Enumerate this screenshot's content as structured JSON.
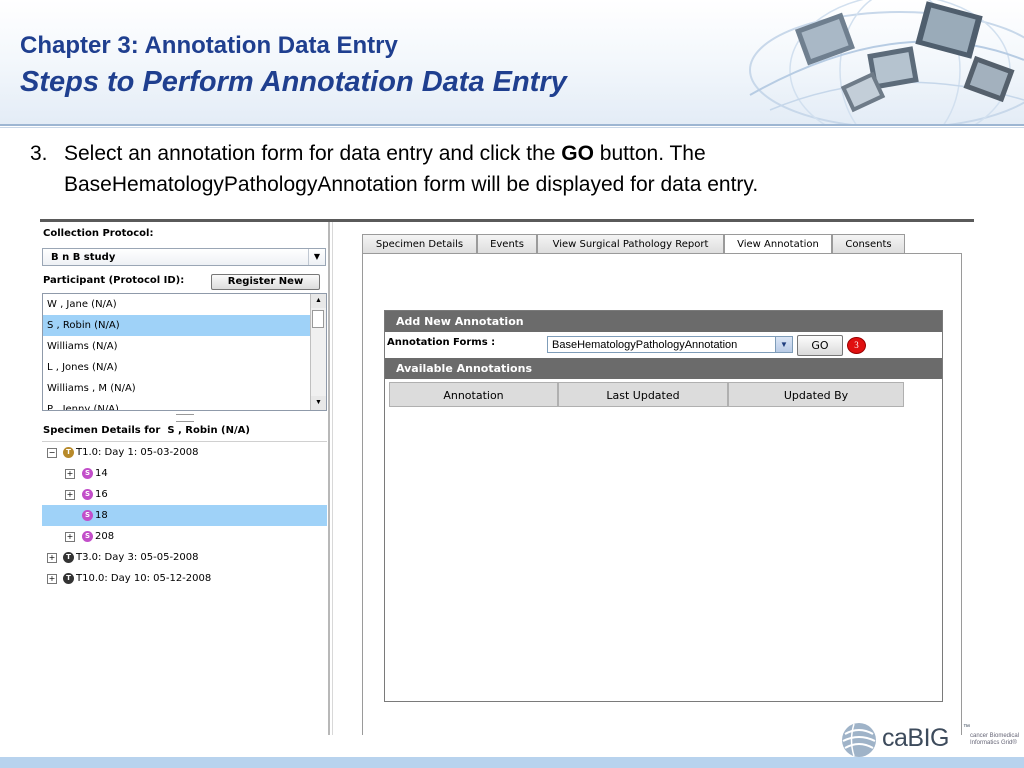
{
  "slide": {
    "chapter_title": "Chapter 3: Annotation Data Entry",
    "subtitle": "Steps to Perform Annotation Data Entry"
  },
  "step": {
    "number": "3.",
    "text_before": "Select an annotation form for data entry and click the ",
    "bold_word": "GO",
    "text_after": " button. The BaseHematologyPathologyAnnotation form will be displayed for data entry."
  },
  "left_panel": {
    "collection_protocol_label": "Collection Protocol:",
    "collection_protocol_value": "B n B study",
    "participant_label": "Participant (Protocol ID):",
    "register_new_label": "Register New",
    "participants": [
      {
        "name": "W , Jane (N/A)",
        "selected": false
      },
      {
        "name": "S , Robin (N/A)",
        "selected": true
      },
      {
        "name": "Williams (N/A)",
        "selected": false
      },
      {
        "name": "L , Jones (N/A)",
        "selected": false
      },
      {
        "name": "Williams , M (N/A)",
        "selected": false
      },
      {
        "name": "P , Jenny (N/A)",
        "selected": false
      }
    ],
    "specimen_details_label": "Specimen Details for",
    "specimen_details_for": "S , Robin (N/A)",
    "tree": [
      {
        "label": "T1.0: Day 1: 05-03-2008",
        "toggle": "−",
        "icon": "T",
        "level": 0
      },
      {
        "label": "14",
        "toggle": "+",
        "icon": "S",
        "level": 1
      },
      {
        "label": "16",
        "toggle": "+",
        "icon": "S",
        "level": 1
      },
      {
        "label": "18",
        "toggle": "",
        "icon": "S",
        "level": 1,
        "selected": true
      },
      {
        "label": "208",
        "toggle": "+",
        "icon": "S",
        "level": 1
      },
      {
        "label": "T3.0: Day 3: 05-05-2008",
        "toggle": "+",
        "icon": "T",
        "level": 0
      },
      {
        "label": "T10.0: Day 10: 05-12-2008",
        "toggle": "+",
        "icon": "T",
        "level": 0
      }
    ]
  },
  "tabs": [
    {
      "label": "Specimen Details",
      "active": false
    },
    {
      "label": "Events",
      "active": false
    },
    {
      "label": "View Surgical Pathology Report",
      "active": false
    },
    {
      "label": "View Annotation",
      "active": true
    },
    {
      "label": "Consents",
      "active": false
    }
  ],
  "annotation_panel": {
    "add_new_title": "Add New Annotation",
    "forms_label": "Annotation Forms :",
    "forms_value": "BaseHematologyPathologyAnnotation",
    "go_label": "GO",
    "callout_number": "3",
    "available_title": "Available Annotations",
    "columns": [
      "Annotation",
      "Last Updated",
      "Updated By"
    ]
  },
  "footer": {
    "logo_text": "caBIG",
    "trademark": "™",
    "logo_tagline": "cancer Biomedical Informatics Grid®"
  },
  "colors": {
    "title_blue": "#1f3f8f",
    "selection_blue": "#9fd2f8",
    "panel_bar_gray": "#6b6b6b",
    "callout_red": "#e01010",
    "footer_blue": "#b8d3ee"
  }
}
